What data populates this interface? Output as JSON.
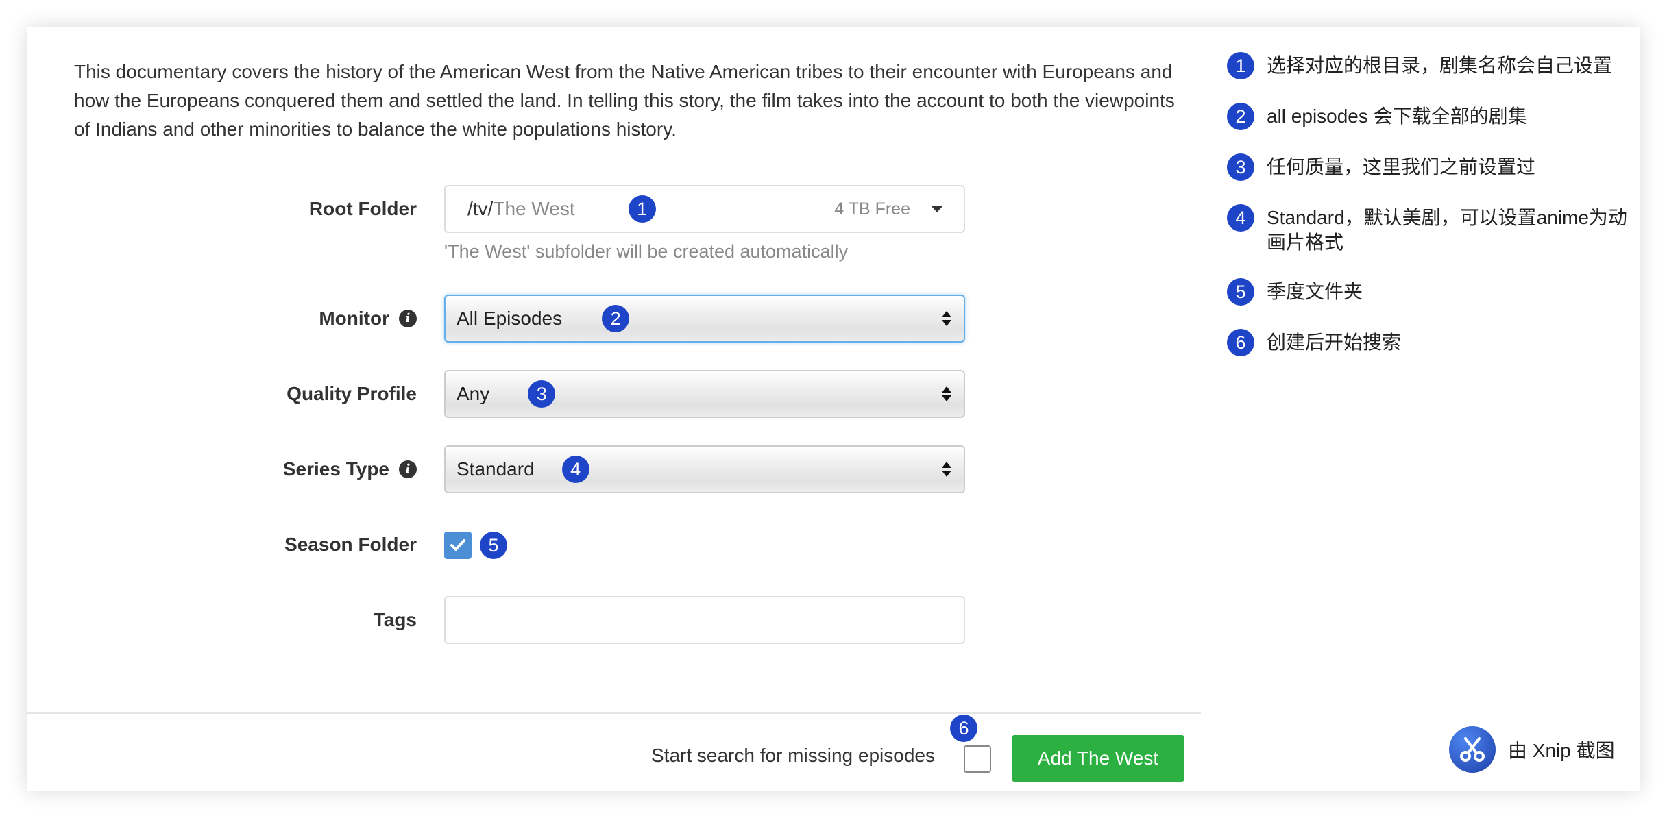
{
  "series": {
    "overview": "This documentary covers the history of the American West from the Native American tribes to their encounter with Europeans and how the Europeans conquered them and settled the land. In telling this story, the film takes into the account to both the viewpoints of Indians and other minorities to balance the white populations history."
  },
  "form": {
    "root_folder": {
      "label": "Root Folder",
      "path": "/tv/",
      "subfolder": "The West",
      "free_space": "4 TB Free",
      "hint": "'The West' subfolder will be created automatically",
      "marker": "1"
    },
    "monitor": {
      "label": "Monitor",
      "value": "All Episodes",
      "marker": "2"
    },
    "quality_profile": {
      "label": "Quality Profile",
      "value": "Any",
      "marker": "3"
    },
    "series_type": {
      "label": "Series Type",
      "value": "Standard",
      "marker": "4"
    },
    "season_folder": {
      "label": "Season Folder",
      "checked": true,
      "marker": "5"
    },
    "tags": {
      "label": "Tags",
      "value": ""
    }
  },
  "footer": {
    "search_label": "Start search for missing episodes",
    "search_checked": false,
    "marker": "6",
    "add_button": "Add The West",
    "add_button_color": "#2cb041"
  },
  "notes": [
    {
      "number": "1",
      "text": "选择对应的根目录，剧集名称会自己设置"
    },
    {
      "number": "2",
      "text": "all episodes 会下载全部的剧集"
    },
    {
      "number": "3",
      "text": "任何质量，这里我们之前设置过"
    },
    {
      "number": "4",
      "text": "Standard，默认美剧，可以设置anime为动画片格式"
    },
    {
      "number": "5",
      "text": "季度文件夹"
    },
    {
      "number": "6",
      "text": "创建后开始搜索"
    }
  ],
  "watermark": {
    "text": "由 Xnip 截图",
    "icon": "scissors-icon"
  },
  "colors": {
    "marker": "#1e45c8",
    "checkbox": "#4d8fd6",
    "focus_border": "#66afe9"
  }
}
